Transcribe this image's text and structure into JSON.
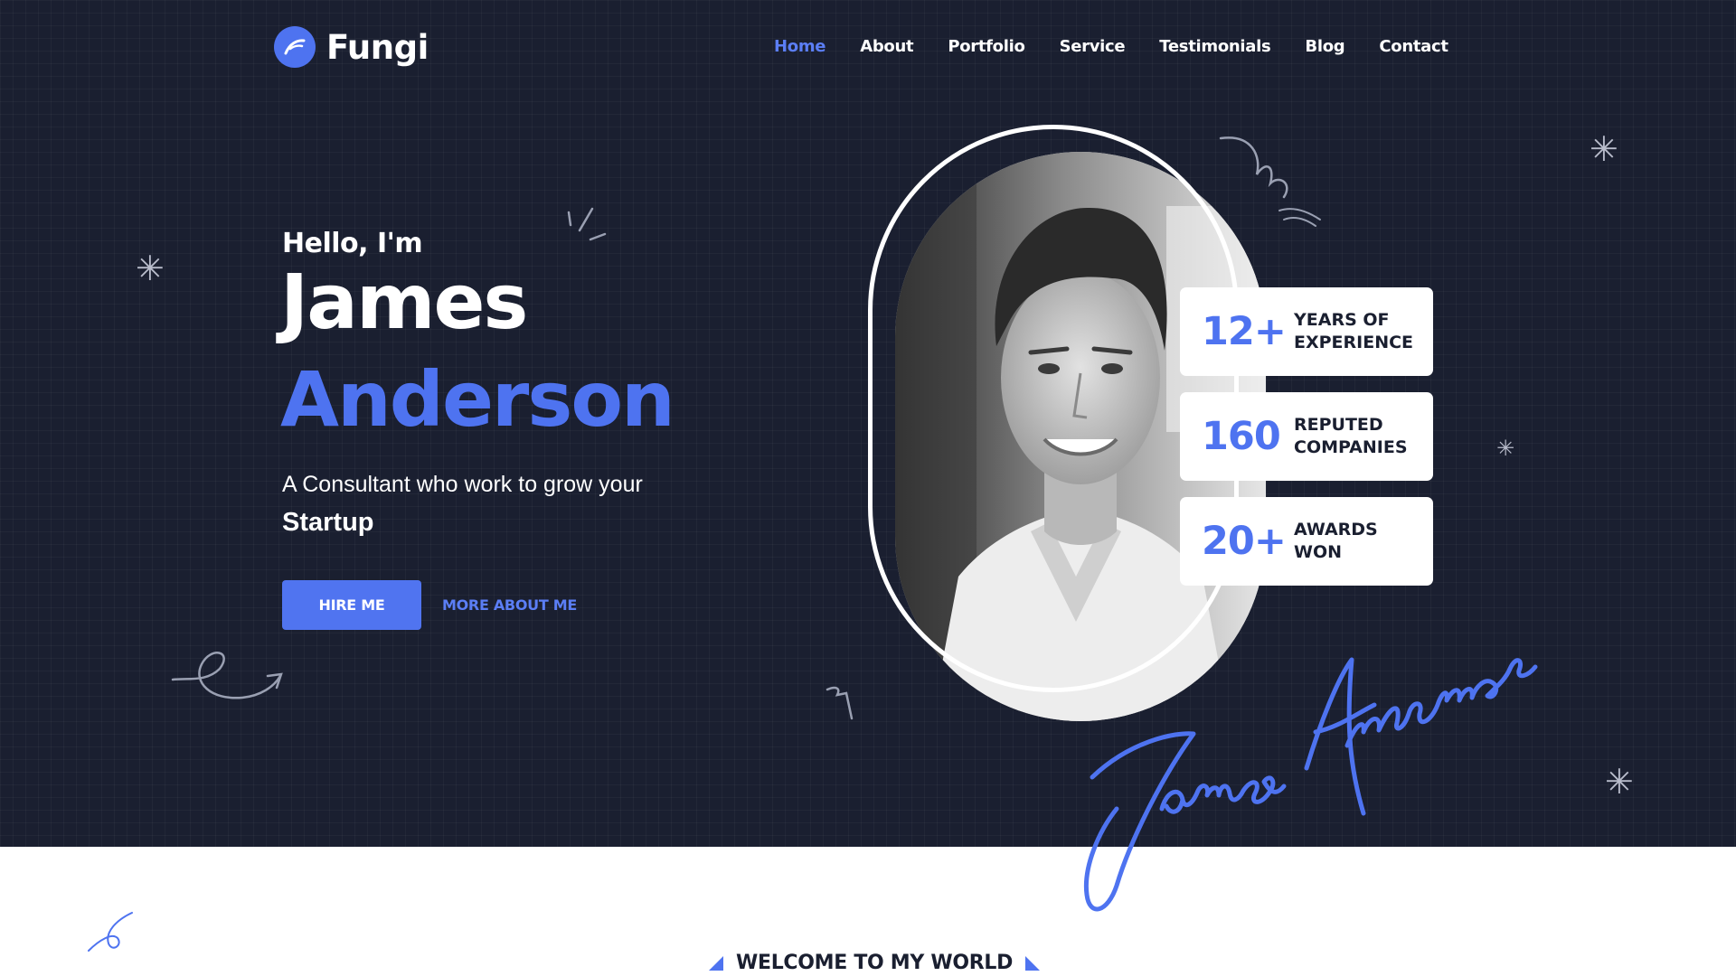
{
  "brand": {
    "name": "Fungi",
    "accent_color": "#4e73f0",
    "background_color": "#1a1f30"
  },
  "nav": {
    "items": [
      {
        "label": "Home",
        "active": true
      },
      {
        "label": "About",
        "active": false
      },
      {
        "label": "Portfolio",
        "active": false
      },
      {
        "label": "Service",
        "active": false
      },
      {
        "label": "Testimonials",
        "active": false
      },
      {
        "label": "Blog",
        "active": false
      },
      {
        "label": "Contact",
        "active": false
      }
    ]
  },
  "hero": {
    "greeting": "Hello, I'm",
    "first_name": "James",
    "last_name": "Anderson",
    "tagline_prefix": "A Consultant who work to grow your",
    "tagline_emphasis": "Startup",
    "primary_button": "HIRE ME",
    "secondary_link": "MORE ABOUT ME",
    "signature": "James Anderson"
  },
  "stats": [
    {
      "value": "12+",
      "label": "YEARS OF EXPERIENCE"
    },
    {
      "value": "160",
      "label": "REPUTED COMPANIES"
    },
    {
      "value": "20+",
      "label": "AWARDS WON"
    }
  ],
  "welcome": {
    "title": "WELCOME TO MY WORLD"
  },
  "icons": {
    "logo": "feather-logo-icon",
    "decorations": [
      "asterisk-icon",
      "squiggle-arrow-icon",
      "swirl-icon",
      "triangle-marker-icon"
    ]
  }
}
